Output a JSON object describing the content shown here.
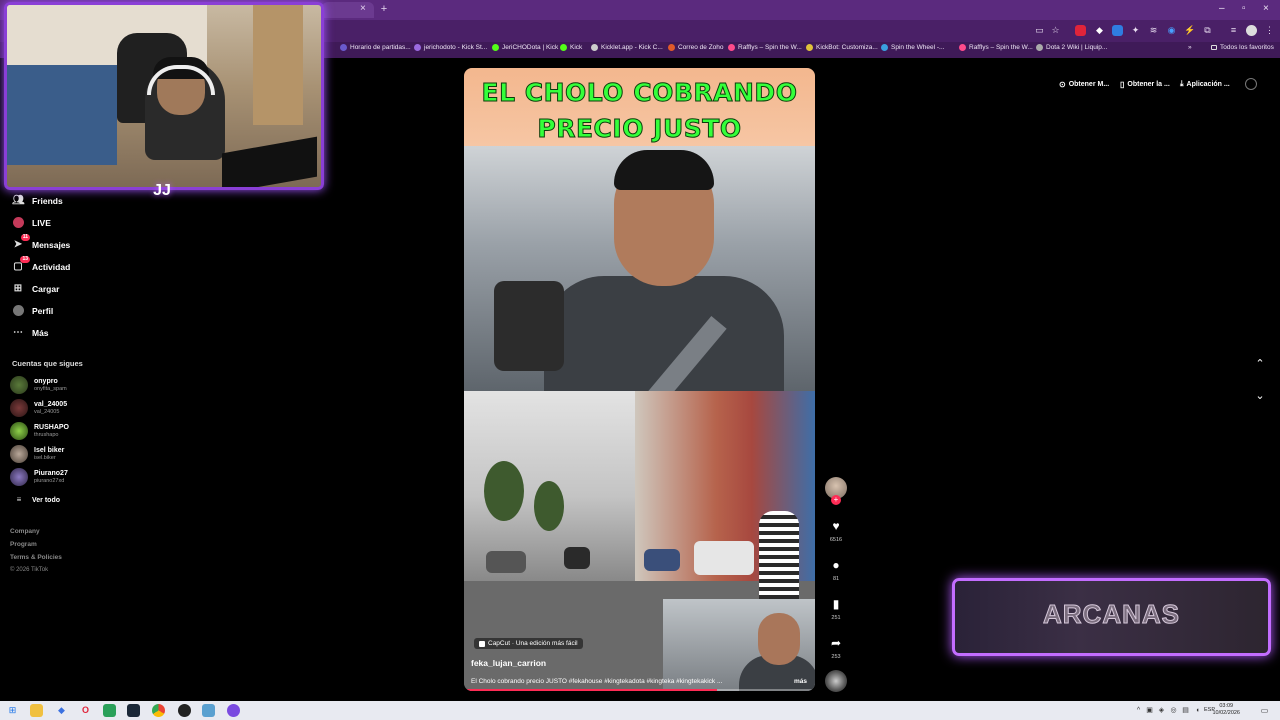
{
  "browser": {
    "bookmarks": [
      "Horario de partidas...",
      "jerichodoto - Kick St...",
      "JeriCHODota | Kick",
      "Kick",
      "Kicklet.app - Kick C...",
      "Correo de Zoho",
      "Rafflys – Spin the W...",
      "KickBot: Customiza...",
      "Spin the Wheel -...",
      "Rafflys – Spin the W...",
      "Dota 2 Wiki | Liquip..."
    ],
    "all_bookmarks": "Todos los favoritos"
  },
  "sidebar": {
    "items": [
      {
        "label": "Friends",
        "icon": "friends-icon"
      },
      {
        "label": "LIVE",
        "icon": "live-icon"
      },
      {
        "label": "Mensajes",
        "icon": "messages-icon",
        "badge": "11"
      },
      {
        "label": "Actividad",
        "icon": "activity-icon",
        "badge": "13"
      },
      {
        "label": "Cargar",
        "icon": "upload-icon"
      },
      {
        "label": "Perfil",
        "icon": "profile-icon"
      },
      {
        "label": "Más",
        "icon": "more-icon"
      }
    ],
    "following_title": "Cuentas que sigues",
    "accounts": [
      {
        "name": "onypro",
        "handle": "onyfita_spam"
      },
      {
        "name": "val_24005",
        "handle": "val_24005"
      },
      {
        "name": "RUSHAPO",
        "handle": "thrushapo"
      },
      {
        "name": "Isel biker",
        "handle": "isel.biker"
      },
      {
        "name": "Piurano27",
        "handle": "piurano27xd"
      }
    ],
    "see_all": "Ver todo",
    "footer": [
      "Company",
      "Program",
      "Terms & Policies",
      "© 2026 TikTok"
    ]
  },
  "top_actions": [
    "Obtener M...",
    "Obtener la ...",
    "Aplicación ..."
  ],
  "video": {
    "title_line1": "EL CHOLO COBRANDO",
    "title_line2": "PRECIO JUSTO",
    "capcut": "CapCut · Una edición más fácil",
    "username": "feka_lujan_carrion",
    "caption": "El Cholo cobrando precio JUSTO #fekahouse #kingtekadota #kingteka #kingtekakick ...",
    "more": "más",
    "progress": 0.72
  },
  "actions": {
    "likes": "6516",
    "comments": "81",
    "saves": "251",
    "shares": "253"
  },
  "overlay": {
    "arcanas": "ARCANAS"
  },
  "taskbar": {
    "lang": "ESP",
    "time": "03:09",
    "date": "10/02/2026"
  },
  "colors": {
    "accent": "#fe2c55",
    "frame": "#b35cff",
    "title_green": "#35ff3a"
  }
}
